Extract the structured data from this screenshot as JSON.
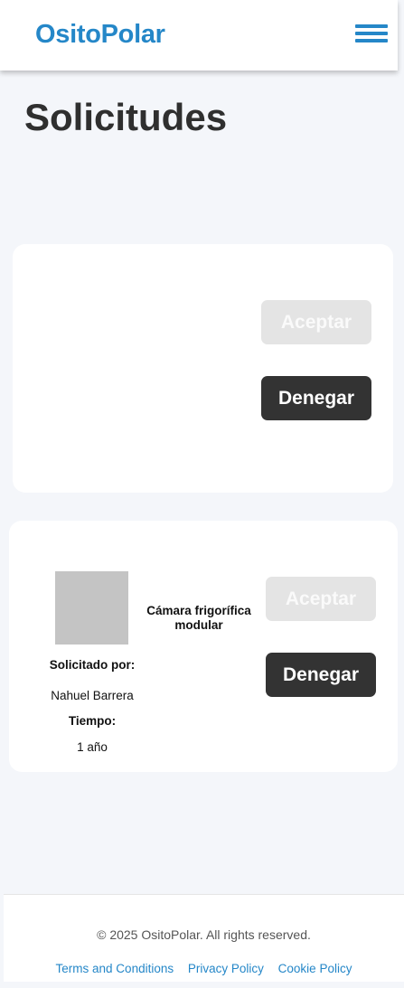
{
  "navbar": {
    "brand": "OsitoPolar",
    "menu_icon": "hamburger-menu-icon",
    "brand_color": "#2587c8"
  },
  "page": {
    "title": "Solicitudes"
  },
  "requests": [
    {
      "accept_label": "Aceptar",
      "deny_label": "Denegar"
    },
    {
      "product_name": "Cámara frigorífica modular",
      "requested_by_label": "Solicitado por:",
      "requested_by": "Nahuel Barrera",
      "time_label": "Tiempo:",
      "time": "1 año",
      "accept_label": "Aceptar",
      "deny_label": "Denegar"
    }
  ],
  "footer": {
    "copyright": "© 2025 OsitoPolar. All rights reserved.",
    "links": [
      "Terms and Conditions",
      "Privacy Policy",
      "Cookie Policy"
    ]
  },
  "colors": {
    "accept_disabled": "#e4e4e4",
    "deny": "#333333",
    "background": "#f4f6fa"
  }
}
